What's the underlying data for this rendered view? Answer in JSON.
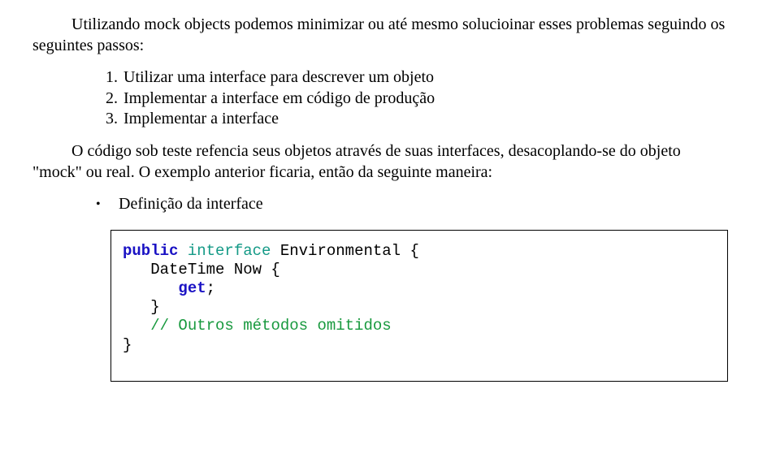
{
  "intro": {
    "line": "Utilizando mock objects podemos minimizar ou até mesmo solucioinar esses problemas seguindo os seguintes passos:"
  },
  "steps": {
    "items": [
      {
        "num": "1.",
        "text": "Utilizar uma interface para descrever um objeto"
      },
      {
        "num": "2.",
        "text": "Implementar a interface em código de produção"
      },
      {
        "num": "3.",
        "text": "Implementar a interface"
      }
    ]
  },
  "body": {
    "line": "O código sob teste refencia seus objetos através de suas interfaces, desacoplando-se do objeto \"mock\" ou real. O exemplo anterior ficaria, então da seguinte maneira:"
  },
  "bullet": {
    "dot": "•",
    "label": "Definição da interface"
  },
  "code": {
    "l1_kw1": "public",
    "l1_type": " interface",
    "l1_rest": " Environmental {",
    "l2": "   DateTime Now {",
    "l3a": "      ",
    "l3_kw": "get",
    "l3b": ";",
    "l4": "   }",
    "l5a": "   ",
    "l5_cmnt": "// Outros métodos omitidos",
    "l6": "}"
  }
}
